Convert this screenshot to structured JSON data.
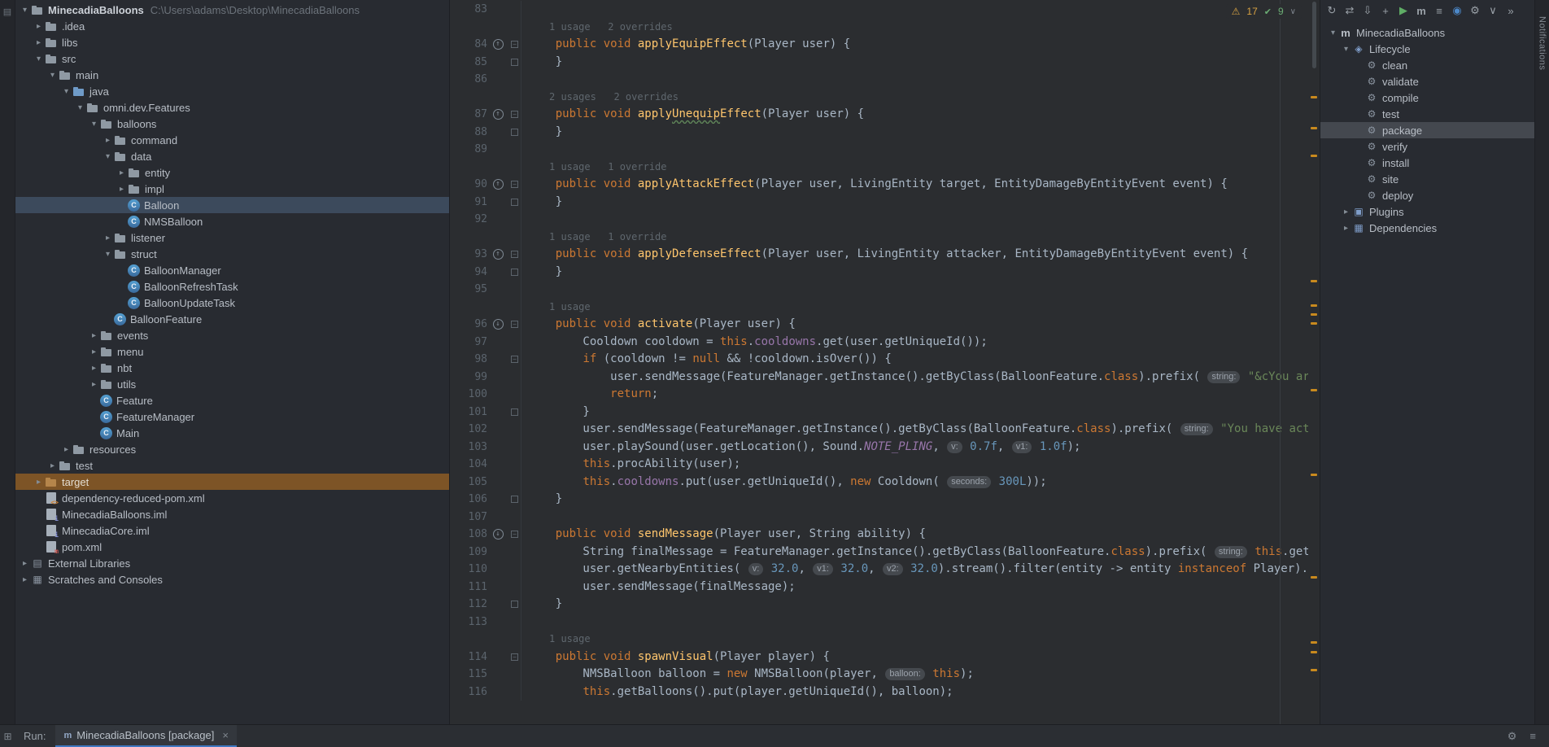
{
  "colors": {
    "editor_bg": "#2b2d30",
    "panel_bg": "#282b31",
    "selection_blue": "#3c4a5c",
    "excluded_orange": "#7d5426",
    "warning_orange": "#c98a1e",
    "keyword_orange": "#cc7832",
    "string_green": "#6a8759",
    "number_blue": "#6897bb",
    "field_purple": "#9876aa",
    "method_yellow": "#ffc66d"
  },
  "left_stripe": {
    "top_icon": "▤"
  },
  "right_stripe": {
    "label": "Notifications"
  },
  "inspections": {
    "warn_icon": "⚠",
    "warn": "17",
    "ok_icon": "✔",
    "ok": "9",
    "chevron": "∨"
  },
  "project": {
    "items": [
      {
        "d": 0,
        "chev": "down",
        "icon": "project",
        "label": "MinecadiaBalloons",
        "path": "C:\\Users\\adams\\Desktop\\MinecadiaBalloons",
        "bold": true
      },
      {
        "d": 1,
        "chev": "right",
        "icon": "folder",
        "label": ".idea"
      },
      {
        "d": 1,
        "chev": "right",
        "icon": "folder",
        "label": "libs"
      },
      {
        "d": 1,
        "chev": "down",
        "icon": "folder",
        "label": "src"
      },
      {
        "d": 2,
        "chev": "down",
        "icon": "folder",
        "label": "main"
      },
      {
        "d": 3,
        "chev": "down",
        "icon": "folder-src",
        "label": "java"
      },
      {
        "d": 4,
        "chev": "down",
        "icon": "package",
        "label": "omni.dev.Features"
      },
      {
        "d": 5,
        "chev": "down",
        "icon": "package",
        "label": "balloons"
      },
      {
        "d": 6,
        "chev": "right",
        "icon": "package",
        "label": "command"
      },
      {
        "d": 6,
        "chev": "down",
        "icon": "package",
        "label": "data"
      },
      {
        "d": 7,
        "chev": "right",
        "icon": "package",
        "label": "entity"
      },
      {
        "d": 7,
        "chev": "right",
        "icon": "package",
        "label": "impl"
      },
      {
        "d": 7,
        "chev": "none",
        "icon": "class",
        "label": "Balloon",
        "sel": "selected"
      },
      {
        "d": 7,
        "chev": "none",
        "icon": "class",
        "label": "NMSBalloon"
      },
      {
        "d": 6,
        "chev": "right",
        "icon": "package",
        "label": "listener"
      },
      {
        "d": 6,
        "chev": "down",
        "icon": "package",
        "label": "struct"
      },
      {
        "d": 7,
        "chev": "none",
        "icon": "class",
        "label": "BalloonManager"
      },
      {
        "d": 7,
        "chev": "none",
        "icon": "class",
        "label": "BalloonRefreshTask"
      },
      {
        "d": 7,
        "chev": "none",
        "icon": "class",
        "label": "BalloonUpdateTask"
      },
      {
        "d": 6,
        "chev": "none",
        "icon": "class",
        "label": "BalloonFeature"
      },
      {
        "d": 5,
        "chev": "right",
        "icon": "package",
        "label": "events"
      },
      {
        "d": 5,
        "chev": "right",
        "icon": "package",
        "label": "menu"
      },
      {
        "d": 5,
        "chev": "right",
        "icon": "package",
        "label": "nbt"
      },
      {
        "d": 5,
        "chev": "right",
        "icon": "package",
        "label": "utils"
      },
      {
        "d": 5,
        "chev": "none",
        "icon": "class",
        "label": "Feature"
      },
      {
        "d": 5,
        "chev": "none",
        "icon": "class",
        "label": "FeatureManager"
      },
      {
        "d": 5,
        "chev": "none",
        "icon": "class",
        "label": "Main"
      },
      {
        "d": 3,
        "chev": "right",
        "icon": "folder",
        "label": "resources"
      },
      {
        "d": 2,
        "chev": "right",
        "icon": "folder",
        "label": "test"
      },
      {
        "d": 1,
        "chev": "right",
        "icon": "folder-excluded",
        "label": "target",
        "sel": "excluded"
      },
      {
        "d": 1,
        "chev": "none",
        "icon": "file-xml",
        "label": "dependency-reduced-pom.xml"
      },
      {
        "d": 1,
        "chev": "none",
        "icon": "file-iml",
        "label": "MinecadiaBalloons.iml"
      },
      {
        "d": 1,
        "chev": "none",
        "icon": "file-iml",
        "label": "MinecadiaCore.iml"
      },
      {
        "d": 1,
        "chev": "none",
        "icon": "file-pom",
        "label": "pom.xml"
      },
      {
        "d": 0,
        "chev": "right",
        "icon": "lib",
        "label": "External Libraries"
      },
      {
        "d": 0,
        "chev": "right",
        "icon": "scratch",
        "label": "Scratches and Consoles"
      }
    ]
  },
  "editor": {
    "stripe_marks": [
      118,
      156,
      190,
      344,
      374,
      385,
      396,
      478,
      582,
      708,
      788,
      800,
      822
    ],
    "lines": [
      {
        "n": 83,
        "s": []
      },
      {
        "lens": "1 usage   2 overrides"
      },
      {
        "n": 84,
        "g": "override",
        "f": "start",
        "s": [
          [
            "    ",
            "p"
          ],
          [
            "public void ",
            "k"
          ],
          [
            "applyEquipEffect",
            "d"
          ],
          [
            "(Player user) {",
            "p"
          ]
        ]
      },
      {
        "n": 85,
        "f": "end",
        "s": [
          [
            "    }",
            "p"
          ]
        ]
      },
      {
        "n": 86,
        "s": []
      },
      {
        "lens": "2 usages   2 overrides"
      },
      {
        "n": 87,
        "g": "override",
        "f": "start",
        "s": [
          [
            "    ",
            "p"
          ],
          [
            "public void ",
            "k"
          ],
          [
            "apply",
            "d"
          ],
          [
            "Unequip",
            "w"
          ],
          [
            "Effect",
            "d"
          ],
          [
            "(Player user) {",
            "p"
          ]
        ]
      },
      {
        "n": 88,
        "f": "end",
        "s": [
          [
            "    }",
            "p"
          ]
        ]
      },
      {
        "n": 89,
        "s": []
      },
      {
        "lens": "1 usage   1 override"
      },
      {
        "n": 90,
        "g": "override",
        "f": "start",
        "s": [
          [
            "    ",
            "p"
          ],
          [
            "public void ",
            "k"
          ],
          [
            "applyAttackEffect",
            "d"
          ],
          [
            "(Player user, LivingEntity target, EntityDamageByEntityEvent event) {",
            "p"
          ]
        ]
      },
      {
        "n": 91,
        "f": "end",
        "s": [
          [
            "    }",
            "p"
          ]
        ]
      },
      {
        "n": 92,
        "s": []
      },
      {
        "lens": "1 usage   1 override"
      },
      {
        "n": 93,
        "g": "override",
        "f": "start",
        "s": [
          [
            "    ",
            "p"
          ],
          [
            "public void ",
            "k"
          ],
          [
            "applyDefenseEffect",
            "d"
          ],
          [
            "(Player user, LivingEntity attacker, EntityDamageByEntityEvent event) {",
            "p"
          ]
        ]
      },
      {
        "n": 94,
        "f": "end",
        "s": [
          [
            "    }",
            "p"
          ]
        ]
      },
      {
        "n": 95,
        "s": []
      },
      {
        "lens": "1 usage"
      },
      {
        "n": 96,
        "g": "overridden",
        "f": "start",
        "s": [
          [
            "    ",
            "p"
          ],
          [
            "public void ",
            "k"
          ],
          [
            "activate",
            "d"
          ],
          [
            "(Player user) {",
            "p"
          ]
        ]
      },
      {
        "n": 97,
        "s": [
          [
            "        Cooldown cooldown = ",
            "p"
          ],
          [
            "this",
            "k"
          ],
          [
            ".",
            "p"
          ],
          [
            "cooldowns",
            "f"
          ],
          [
            ".get(user.getUniqueId());",
            "p"
          ]
        ]
      },
      {
        "n": 98,
        "f": "start",
        "s": [
          [
            "        ",
            "p"
          ],
          [
            "if",
            "k"
          ],
          [
            " (cooldown != ",
            "p"
          ],
          [
            "null",
            "k"
          ],
          [
            " && !cooldown.isOver()) {",
            "p"
          ]
        ]
      },
      {
        "n": 99,
        "s": [
          [
            "            user.sendMessage(FeatureManager.getInstance().getByClass(BalloonFeature.",
            "p"
          ],
          [
            "class",
            "k"
          ],
          [
            ").prefix( ",
            "p"
          ],
          [
            "string:",
            "h"
          ],
          [
            " ",
            "p"
          ],
          [
            "\"&cYou are currently",
            "s"
          ]
        ]
      },
      {
        "n": 100,
        "s": [
          [
            "            ",
            "p"
          ],
          [
            "return",
            "k"
          ],
          [
            ";",
            "p"
          ]
        ]
      },
      {
        "n": 101,
        "f": "end",
        "s": [
          [
            "        }",
            "p"
          ]
        ]
      },
      {
        "n": 102,
        "s": [
          [
            "        user.sendMessage(FeatureManager.getInstance().getByClass(BalloonFeature.",
            "p"
          ],
          [
            "class",
            "k"
          ],
          [
            ").prefix( ",
            "p"
          ],
          [
            "string:",
            "h"
          ],
          [
            " ",
            "p"
          ],
          [
            "\"You have activated your",
            "s"
          ]
        ]
      },
      {
        "n": 103,
        "s": [
          [
            "        user.playSound(user.getLocation(), Sound.",
            "p"
          ],
          [
            "NOTE_PLING",
            "c"
          ],
          [
            ", ",
            "p"
          ],
          [
            "v:",
            "h"
          ],
          [
            " ",
            "p"
          ],
          [
            "0.7f",
            "n"
          ],
          [
            ", ",
            "p"
          ],
          [
            "v1:",
            "h"
          ],
          [
            " ",
            "p"
          ],
          [
            "1.0f",
            "n"
          ],
          [
            ");",
            "p"
          ]
        ]
      },
      {
        "n": 104,
        "s": [
          [
            "        ",
            "p"
          ],
          [
            "this",
            "k"
          ],
          [
            ".procAbility(user);",
            "p"
          ]
        ]
      },
      {
        "n": 105,
        "s": [
          [
            "        ",
            "p"
          ],
          [
            "this",
            "k"
          ],
          [
            ".",
            "p"
          ],
          [
            "cooldowns",
            "f"
          ],
          [
            ".put(user.getUniqueId(), ",
            "p"
          ],
          [
            "new",
            "k"
          ],
          [
            " Cooldown( ",
            "p"
          ],
          [
            "seconds:",
            "h"
          ],
          [
            " ",
            "p"
          ],
          [
            "300L",
            "n"
          ],
          [
            "));",
            "p"
          ]
        ]
      },
      {
        "n": 106,
        "f": "end",
        "s": [
          [
            "    }",
            "p"
          ]
        ]
      },
      {
        "n": 107,
        "s": []
      },
      {
        "n": 108,
        "g": "overridden",
        "f": "start",
        "s": [
          [
            "    ",
            "p"
          ],
          [
            "public void ",
            "k"
          ],
          [
            "sendMessage",
            "d"
          ],
          [
            "(Player user, String ability) {",
            "p"
          ]
        ]
      },
      {
        "n": 109,
        "s": [
          [
            "        String finalMessage = FeatureManager.getInstance().getByClass(BalloonFeature.",
            "p"
          ],
          [
            "class",
            "k"
          ],
          [
            ").prefix( ",
            "p"
          ],
          [
            "string:",
            "h"
          ],
          [
            " ",
            "p"
          ],
          [
            "this",
            "k"
          ],
          [
            ".getDisplayColo",
            "p"
          ]
        ]
      },
      {
        "n": 110,
        "s": [
          [
            "        user.getNearbyEntities( ",
            "p"
          ],
          [
            "v:",
            "h"
          ],
          [
            " ",
            "p"
          ],
          [
            "32.0",
            "n"
          ],
          [
            ", ",
            "p"
          ],
          [
            "v1:",
            "h"
          ],
          [
            " ",
            "p"
          ],
          [
            "32.0",
            "n"
          ],
          [
            ", ",
            "p"
          ],
          [
            "v2:",
            "h"
          ],
          [
            " ",
            "p"
          ],
          [
            "32.0",
            "n"
          ],
          [
            ").stream().filter(entity -> entity ",
            "p"
          ],
          [
            "instanceof",
            "k"
          ],
          [
            " Player).forEach(entit",
            "p"
          ]
        ]
      },
      {
        "n": 111,
        "s": [
          [
            "        user.sendMessage(finalMessage);",
            "p"
          ]
        ]
      },
      {
        "n": 112,
        "f": "end",
        "s": [
          [
            "    }",
            "p"
          ]
        ]
      },
      {
        "n": 113,
        "s": []
      },
      {
        "lens": "1 usage"
      },
      {
        "n": 114,
        "f": "start",
        "s": [
          [
            "    ",
            "p"
          ],
          [
            "public void ",
            "k"
          ],
          [
            "spawnVisual",
            "d"
          ],
          [
            "(Player player) {",
            "p"
          ]
        ]
      },
      {
        "n": 115,
        "s": [
          [
            "        NMSBalloon balloon = ",
            "p"
          ],
          [
            "new",
            "k"
          ],
          [
            " NMSBalloon(player, ",
            "p"
          ],
          [
            "balloon:",
            "h"
          ],
          [
            " ",
            "p"
          ],
          [
            "this",
            "k"
          ],
          [
            ");",
            "p"
          ]
        ]
      },
      {
        "n": 116,
        "s": [
          [
            "        ",
            "p"
          ],
          [
            "this",
            "k"
          ],
          [
            ".getBalloons().put(player.getUniqueId(), balloon);",
            "p"
          ]
        ]
      }
    ]
  },
  "maven": {
    "toolbar": [
      {
        "glyph": "↻",
        "name": "reload-maven-projects-icon"
      },
      {
        "glyph": "⇄",
        "name": "generate-sources-icon"
      },
      {
        "glyph": "⇩",
        "name": "download-sources-icon"
      },
      {
        "glyph": "+",
        "name": "add-maven-project-icon"
      },
      {
        "glyph": "▶",
        "name": "run-build-icon",
        "cls": "green"
      },
      {
        "glyph": "m",
        "name": "execute-maven-goal-icon",
        "cls": "mbold"
      },
      {
        "glyph": "≡",
        "name": "toggle-view-icon"
      },
      {
        "glyph": "◉",
        "name": "offline-mode-icon",
        "cls": "blue"
      },
      {
        "glyph": "⚙",
        "name": "maven-settings-icon"
      },
      {
        "glyph": "∨",
        "name": "collapse-all-icon"
      },
      {
        "glyph": "»",
        "name": "more-options-icon"
      }
    ],
    "items": [
      {
        "d": 0,
        "chev": "down",
        "icon": "maven",
        "label": "MinecadiaBalloons"
      },
      {
        "d": 1,
        "chev": "down",
        "icon": "lifecycle",
        "label": "Lifecycle"
      },
      {
        "d": 2,
        "chev": "none",
        "icon": "goal",
        "label": "clean"
      },
      {
        "d": 2,
        "chev": "none",
        "icon": "goal",
        "label": "validate"
      },
      {
        "d": 2,
        "chev": "none",
        "icon": "goal",
        "label": "compile"
      },
      {
        "d": 2,
        "chev": "none",
        "icon": "goal",
        "label": "test"
      },
      {
        "d": 2,
        "chev": "none",
        "icon": "goal",
        "label": "package",
        "sel": "package"
      },
      {
        "d": 2,
        "chev": "none",
        "icon": "goal",
        "label": "verify"
      },
      {
        "d": 2,
        "chev": "none",
        "icon": "goal",
        "label": "install"
      },
      {
        "d": 2,
        "chev": "none",
        "icon": "goal",
        "label": "site"
      },
      {
        "d": 2,
        "chev": "none",
        "icon": "goal",
        "label": "deploy"
      },
      {
        "d": 1,
        "chev": "right",
        "icon": "plugins",
        "label": "Plugins"
      },
      {
        "d": 1,
        "chev": "right",
        "icon": "deps",
        "label": "Dependencies"
      }
    ]
  },
  "run_bar": {
    "grid_icon": "⊞",
    "run_label": "Run:",
    "tab_icon": "m",
    "tab_label": "MinecadiaBalloons [package]",
    "close_icon": "×",
    "right_icons": [
      {
        "glyph": "⚙",
        "name": "settings-gear-icon"
      },
      {
        "glyph": "≡",
        "name": "options-menu-icon"
      }
    ]
  }
}
